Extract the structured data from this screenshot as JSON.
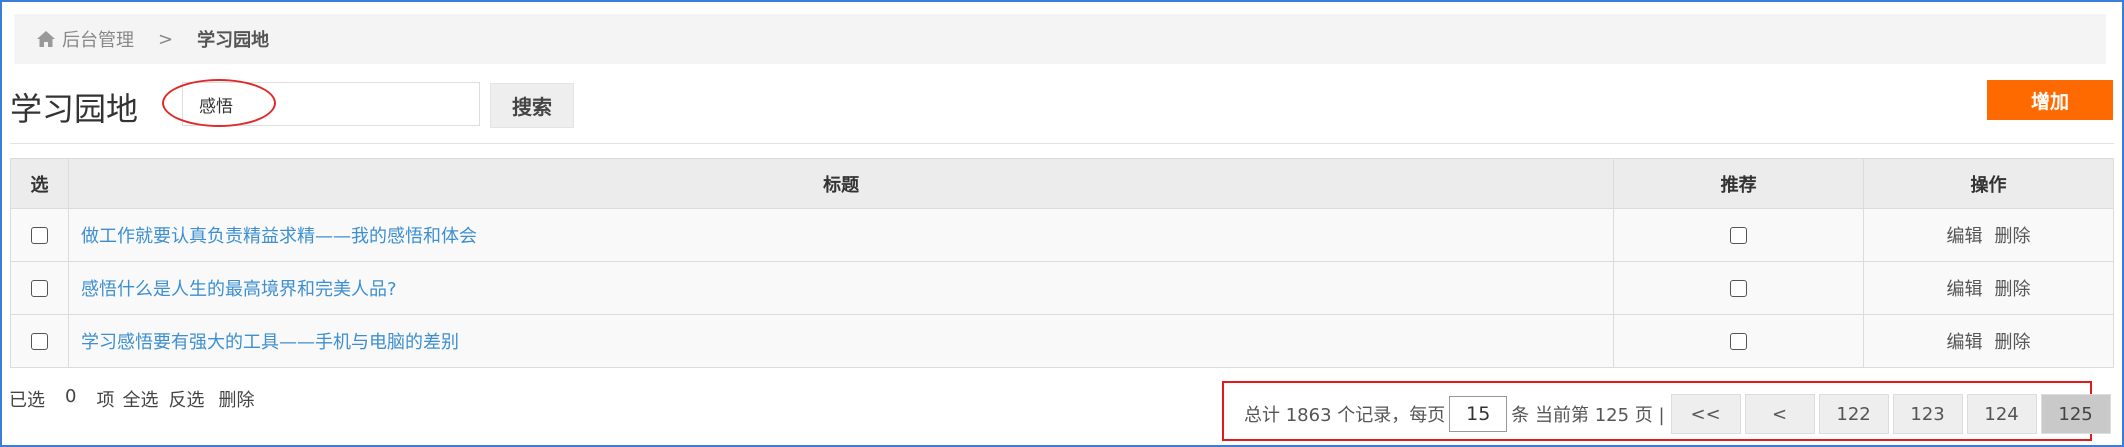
{
  "breadcrumb": {
    "home": "后台管理",
    "separator": ">",
    "current": "学习园地"
  },
  "page": {
    "title": "学习园地"
  },
  "search": {
    "value": "感悟",
    "button_label": "搜索"
  },
  "toolbar": {
    "add_label": "增加"
  },
  "table": {
    "columns": [
      "选",
      "标题",
      "推荐",
      "操作"
    ],
    "rows": [
      {
        "title": "做工作就要认真负责精益求精——我的感悟和体会",
        "edit": "编辑",
        "delete": "删除"
      },
      {
        "title": "感悟什么是人生的最高境界和完美人品?",
        "edit": "编辑",
        "delete": "删除"
      },
      {
        "title": "学习感悟要有强大的工具——手机与电脑的差别",
        "edit": "编辑",
        "delete": "删除"
      }
    ]
  },
  "bulk": {
    "selected_prefix": "已选",
    "selected_count": "0",
    "selected_suffix": "项",
    "select_all": "全选",
    "invert": "反选",
    "delete": "删除"
  },
  "pager": {
    "summary": "总计 1863 个记录，每页",
    "page_size": "15",
    "current_info": "条 当前第 125 页 |",
    "first": "<<",
    "prev": "<",
    "pages": [
      "122",
      "123",
      "124",
      "125"
    ],
    "current_page": "125"
  },
  "colors": {
    "accent": "#ff6a00",
    "link": "#3d8fd1",
    "highlight": "#e31b1b"
  },
  "icons": {
    "breadcrumb": "home-icon"
  }
}
